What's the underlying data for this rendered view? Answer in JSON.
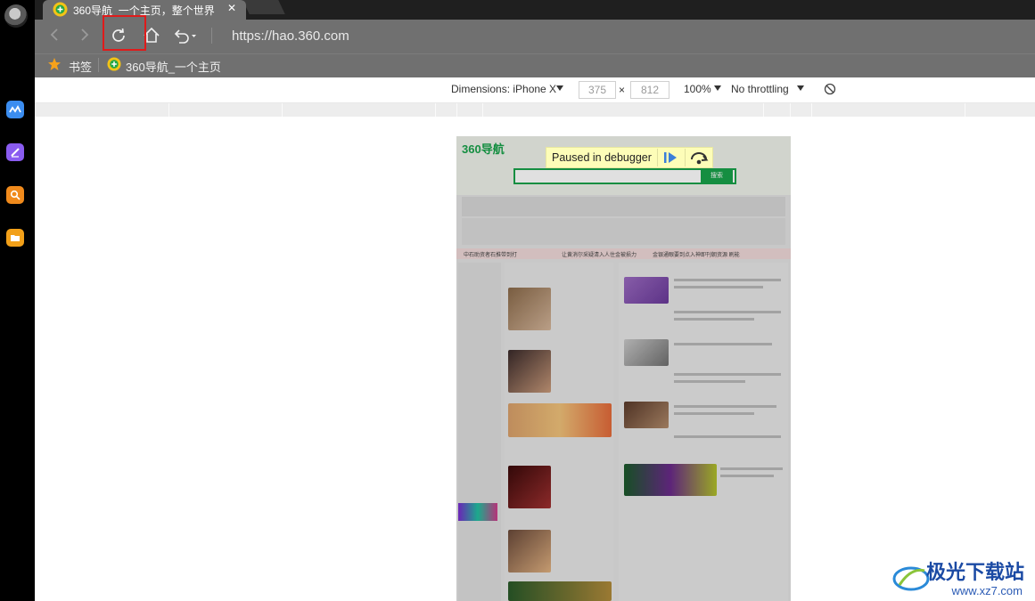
{
  "browser": {
    "tab_title": "360导航_一个主页，整个世界",
    "close_glyph": "✕",
    "url": "https://hao.360.com",
    "bookmarks_label": "书签",
    "bookmark_item": "360导航_一个主页"
  },
  "devtools": {
    "device": "Dimensions: iPhone X",
    "width": "375",
    "times": "×",
    "height": "812",
    "zoom": "100%",
    "throttle": "No throttling"
  },
  "debugger": {
    "paused_label": "Paused in debugger"
  },
  "page": {
    "logo": "360导航",
    "search_button": "搜索",
    "banner_left": "中石助资者石推带到打",
    "banner_mid": "让黄消尔采疑清入人住金被损力",
    "banner_right": "金银通眼要到点入神即刊朝资源 刷能"
  },
  "watermark": {
    "name": "极光下载站",
    "url": "www.xz7.com"
  },
  "colors": {
    "accent_red": "#e01b1b",
    "brand_green": "#19a24a"
  }
}
